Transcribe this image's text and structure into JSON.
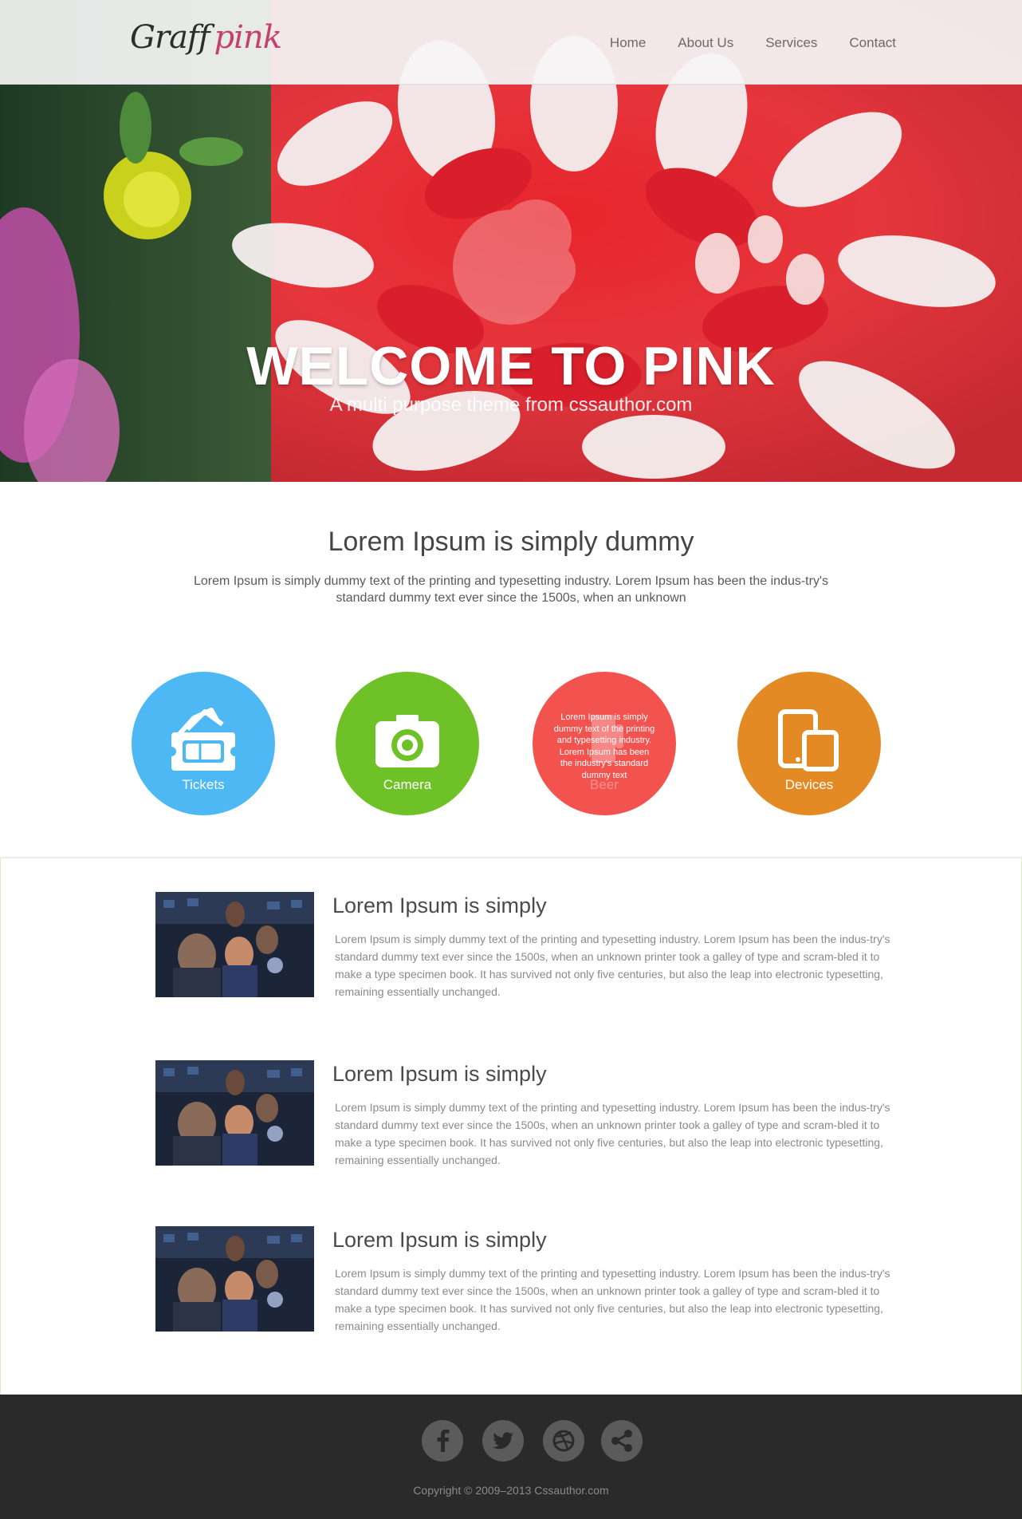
{
  "header": {
    "logo": {
      "word1": "Graff",
      "word2": "pink"
    },
    "nav": [
      "Home",
      "About Us",
      "Services",
      "Contact"
    ]
  },
  "hero": {
    "title": "WELCOME TO PINK",
    "subtitle": "A multi purpose theme from cssauthor.com"
  },
  "intro": {
    "title": "Lorem Ipsum is simply dummy",
    "text": "Lorem Ipsum is simply dummy text of the printing and typesetting industry. Lorem Ipsum has been the indus-try's standard dummy text ever since the 1500s, when an unknown"
  },
  "features": [
    {
      "label": "Tickets",
      "icon": "ticket-icon",
      "color": "#4db8f3"
    },
    {
      "label": "Camera",
      "icon": "camera-icon",
      "color": "#6ec127"
    },
    {
      "label": "Beer",
      "icon": "beer-icon",
      "color": "#f2534f",
      "hover_text": "Lorem Ipsum is simply dummy text of the printing and typesetting industry. Lorem Ipsum has been the industry's standard dummy text"
    },
    {
      "label": "Devices",
      "icon": "devices-icon",
      "color": "#e38a24"
    }
  ],
  "articles": [
    {
      "title": "Lorem Ipsum is simply",
      "text": "Lorem Ipsum is simply dummy text of the printing and typesetting industry. Lorem Ipsum has been the indus-try's standard dummy text ever since the 1500s, when an unknown printer took a galley of type and scram-bled it to make a type specimen book. It has survived not only five centuries, but also the leap into electronic typesetting, remaining essentially unchanged."
    },
    {
      "title": "Lorem Ipsum is simply",
      "text": "Lorem Ipsum is simply dummy text of the printing and typesetting industry. Lorem Ipsum has been the indus-try's standard dummy text ever since the 1500s, when an unknown printer took a galley of type and scram-bled it to make a type specimen book. It has survived not only five centuries, but also the leap into electronic typesetting, remaining essentially unchanged."
    },
    {
      "title": "Lorem Ipsum is simply",
      "text": "Lorem Ipsum is simply dummy text of the printing and typesetting industry. Lorem Ipsum has been the indus-try's standard dummy text ever since the 1500s, when an unknown printer took a galley of type and scram-bled it to make a type specimen book. It has survived not only five centuries, but also the leap into electronic typesetting, remaining essentially unchanged."
    }
  ],
  "footer": {
    "social": [
      "facebook-icon",
      "twitter-icon",
      "dribbble-icon",
      "share-icon"
    ],
    "copyright": "Copyright © 2009–2013 Cssauthor.com"
  },
  "colors": {
    "brand_pink": "#c6406a",
    "tickets": "#4db8f3",
    "camera": "#6ec127",
    "beer": "#f2534f",
    "devices": "#e38a24",
    "footer_bg": "#2a2a2a"
  }
}
